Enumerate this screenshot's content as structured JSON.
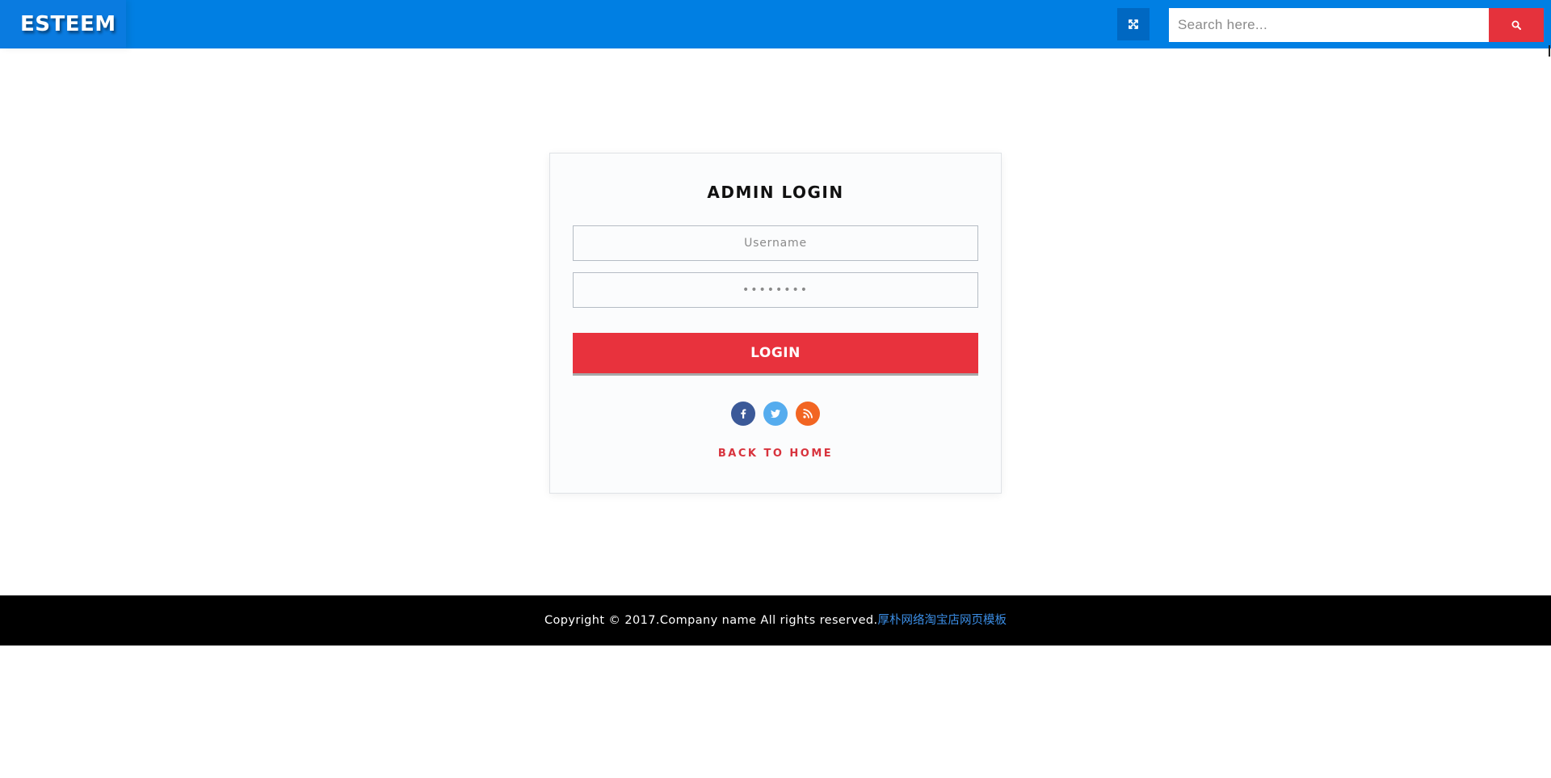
{
  "header": {
    "brand": "ESTEEM",
    "search_placeholder": "Search here..."
  },
  "login": {
    "title": "ADMIN LOGIN",
    "username_placeholder": "Username",
    "password_placeholder": "••••••••",
    "submit_label": "LOGIN",
    "back_link": "BACK TO HOME"
  },
  "footer": {
    "copyright": "Copyright © 2017.Company name All rights reserved.",
    "link_text": "厚朴网络淘宝店网页模板"
  },
  "icons": {
    "expand": "expand-icon",
    "search": "search-icon",
    "facebook": "facebook-icon",
    "twitter": "twitter-icon",
    "rss": "rss-icon"
  },
  "colors": {
    "header_bg": "#007fe3",
    "accent_red": "#e8323d",
    "footer_bg": "#000000",
    "footer_link": "#3b8ee6",
    "facebook": "#3b5998",
    "twitter": "#55acee",
    "rss": "#f26522"
  }
}
